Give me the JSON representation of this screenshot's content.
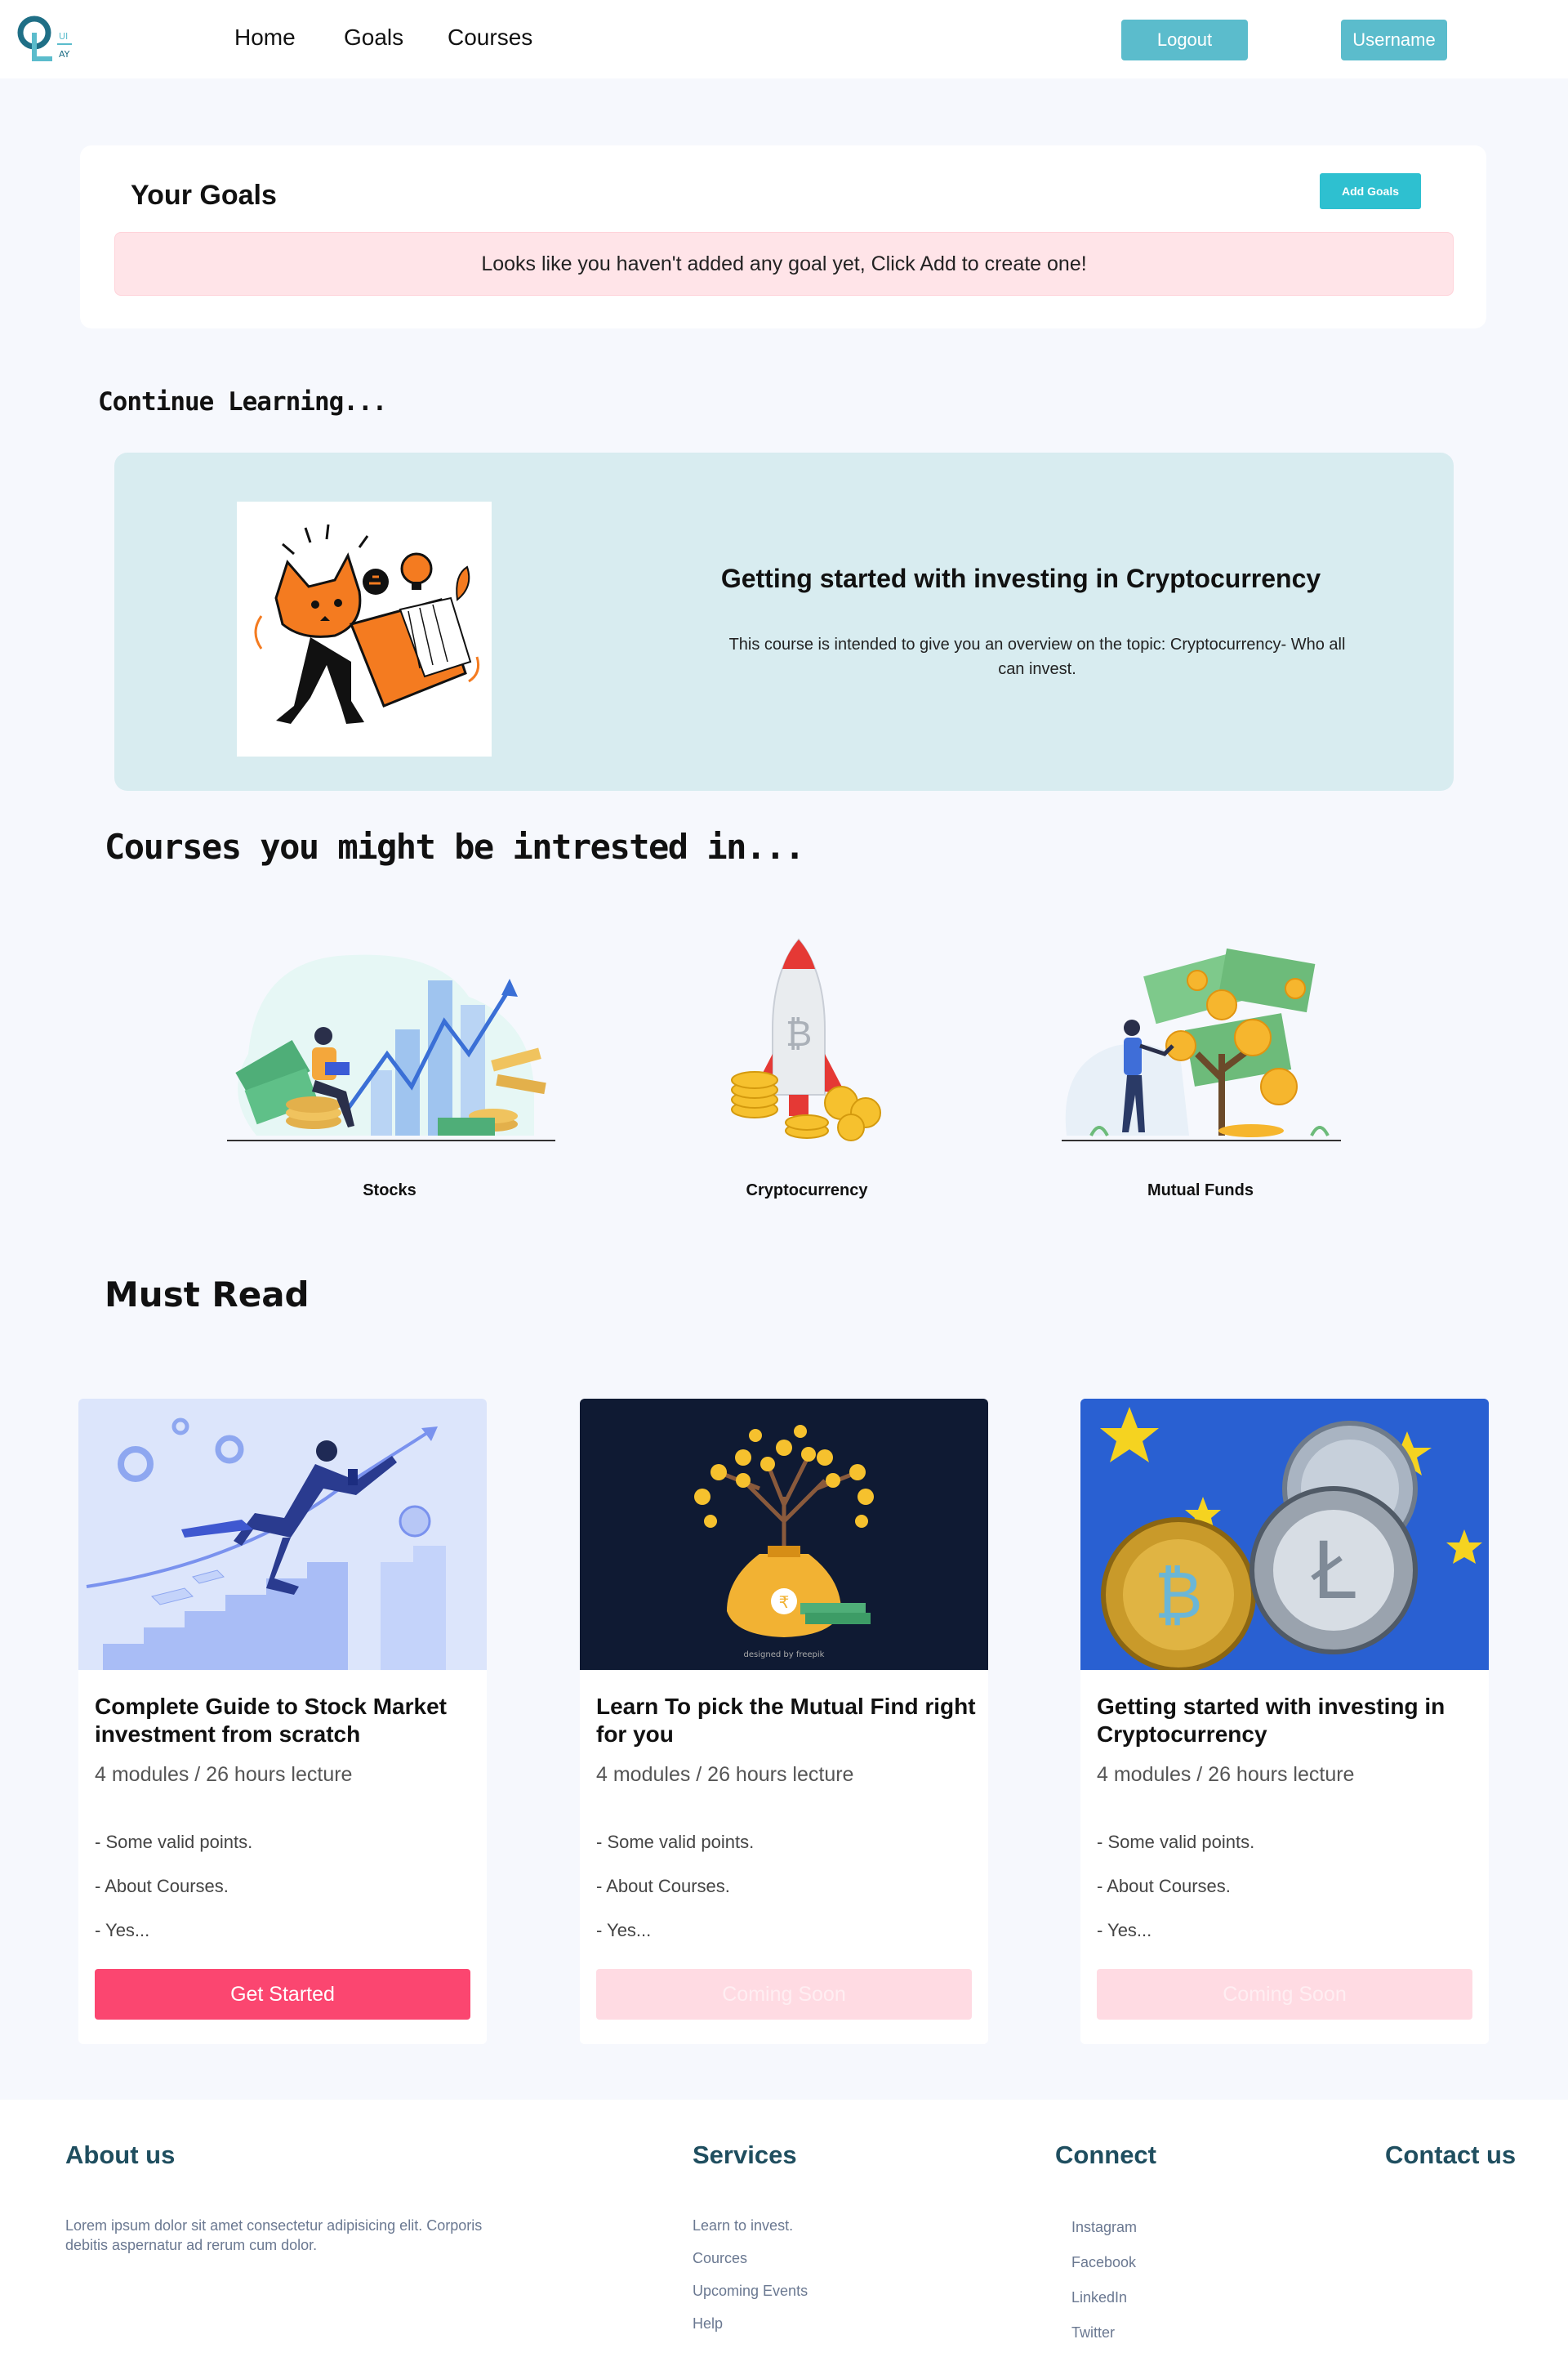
{
  "nav": {
    "links": [
      "Home",
      "Goals",
      "Courses"
    ],
    "logout": "Logout",
    "username": "Username",
    "logo_letters": "Q",
    "logo_small_top": "UI",
    "logo_small_bottom": "AY"
  },
  "goals": {
    "title": "Your Goals",
    "add_button": "Add Goals",
    "empty_message": "Looks like you haven't added any goal yet, Click Add to create one!"
  },
  "continue": {
    "heading": "Continue Learning...",
    "course_title": "Getting started with investing in Cryptocurrency",
    "course_desc": "This course is intended to give you an overview on the topic: Cryptocurrency- Who all can invest."
  },
  "interested": {
    "heading": "Courses you might be intrested in...",
    "topics": [
      "Stocks",
      "Cryptocurrency",
      "Mutual Funds"
    ]
  },
  "must_read": {
    "heading": "Must Read",
    "cards": [
      {
        "title": "Complete Guide to Stock Market investment from scratch",
        "meta": "4 modules / 26 hours lecture",
        "points": [
          "- Some valid points.",
          "- About Courses.",
          "- Yes..."
        ],
        "button": "Get Started",
        "active": true
      },
      {
        "title": "Learn To pick the Mutual Find right for you",
        "meta": "4 modules / 26 hours lecture",
        "points": [
          "- Some valid points.",
          "- About Courses.",
          "- Yes..."
        ],
        "button": "Coming Soon",
        "active": false
      },
      {
        "title": "Getting started with investing in Cryptocurrency",
        "meta": "4 modules / 26 hours lecture",
        "points": [
          "- Some valid points.",
          "- About Courses.",
          "- Yes..."
        ],
        "button": "Coming Soon",
        "active": false
      }
    ],
    "freepik_credit": "designed by freepik"
  },
  "footer": {
    "about_heading": "About us",
    "about_text": "Lorem ipsum dolor sit amet consectetur adipisicing elit. Corporis debitis aspernatur ad rerum cum dolor.",
    "services_heading": "Services",
    "services": [
      "Learn to invest.",
      "Cources",
      "Upcoming Events",
      "Help"
    ],
    "connect_heading": "Connect",
    "connect": [
      "Instagram",
      "Facebook",
      "LinkedIn",
      "Twitter"
    ],
    "contact_heading": "Contact us"
  },
  "colors": {
    "nav_button": "#5bbccc",
    "add_goals": "#2ec0d0",
    "alert_bg": "#ffe4e8",
    "continue_bg": "#d8ecf0",
    "primary_button": "#fb4670",
    "disabled_button": "#ffdbe3",
    "footer_heading": "#1f4e5f"
  }
}
